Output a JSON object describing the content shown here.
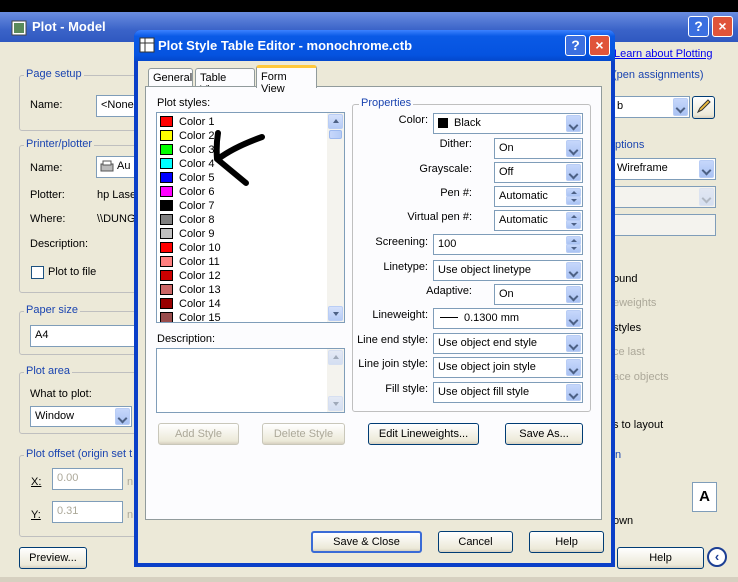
{
  "plot_window": {
    "title": "Plot - Model",
    "help_caption": "?",
    "close_caption": "×",
    "learn_link": "Learn about Plotting",
    "pen_assign": "(pen assignments)",
    "page_setup": {
      "group": "Page setup",
      "name_label": "Name:",
      "name_value": "<None"
    },
    "printer": {
      "group": "Printer/plotter",
      "name_label": "Name:",
      "name_value": "Au",
      "plotter_label": "Plotter:",
      "plotter_value": "hp Lase",
      "where_label": "Where:",
      "where_value": "\\\\DUNG",
      "description_label": "Description:",
      "plot_to_file": "Plot to file"
    },
    "paper": {
      "group": "Paper size",
      "value": "A4"
    },
    "area": {
      "group": "Plot area",
      "what_label": "What to plot:",
      "what_value": "Window"
    },
    "offset": {
      "group": "Plot offset (origin set t",
      "x_label": "X:",
      "x_value": "0.00",
      "x_unit": "n",
      "y_label": "Y:",
      "y_value": "0.31",
      "y_unit": "n"
    },
    "right": {
      "shaded_group": "ptions",
      "shaded_value": "Wireframe",
      "pen_style_value": "b",
      "opt_background": "ound",
      "opt_lineweights": "eweights",
      "opt_styles": "styles",
      "opt_last": "ce last",
      "opt_objects": "ace objects",
      "opt_layout": "s to layout",
      "orient_group": "n",
      "orient_icon": "A",
      "opt_down": "own"
    },
    "preview_button": "Preview...",
    "help_button": "Help"
  },
  "dialog": {
    "title": "Plot Style Table Editor - monochrome.ctb",
    "help_caption": "?",
    "close_caption": "×",
    "tabs": [
      "General",
      "Table View",
      "Form View"
    ],
    "plot_styles_label": "Plot styles:",
    "styles": [
      {
        "name": "Color 1",
        "color": "#ff0000"
      },
      {
        "name": "Color 2",
        "color": "#ffff00"
      },
      {
        "name": "Color 3",
        "color": "#00ff00"
      },
      {
        "name": "Color 4",
        "color": "#00ffff"
      },
      {
        "name": "Color 5",
        "color": "#0000ff"
      },
      {
        "name": "Color 6",
        "color": "#ff00ff"
      },
      {
        "name": "Color 7",
        "color": "#000000"
      },
      {
        "name": "Color 8",
        "color": "#808080"
      },
      {
        "name": "Color 9",
        "color": "#c0c0c0"
      },
      {
        "name": "Color 10",
        "color": "#ff0000"
      },
      {
        "name": "Color 11",
        "color": "#ff7f7f"
      },
      {
        "name": "Color 12",
        "color": "#cc0000"
      },
      {
        "name": "Color 13",
        "color": "#cc6666"
      },
      {
        "name": "Color 14",
        "color": "#990000"
      },
      {
        "name": "Color 15",
        "color": "#994c4c"
      }
    ],
    "description_label": "Description:",
    "add_style": "Add Style",
    "delete_style": "Delete Style",
    "properties": {
      "group": "Properties",
      "color_label": "Color:",
      "color_value": "Black",
      "dither_label": "Dither:",
      "dither_value": "On",
      "grayscale_label": "Grayscale:",
      "grayscale_value": "Off",
      "pen_label": "Pen #:",
      "pen_value": "Automatic",
      "vpen_label": "Virtual pen #:",
      "vpen_value": "Automatic",
      "screening_label": "Screening:",
      "screening_value": "100",
      "linetype_label": "Linetype:",
      "linetype_value": "Use object linetype",
      "adaptive_label": "Adaptive:",
      "adaptive_value": "On",
      "lineweight_label": "Lineweight:",
      "lineweight_value": "0.1300 mm",
      "lineend_label": "Line end style:",
      "lineend_value": "Use object end style",
      "linejoin_label": "Line join style:",
      "linejoin_value": "Use object join style",
      "fill_label": "Fill style:",
      "fill_value": "Use object fill style"
    },
    "edit_lineweights": "Edit Lineweights...",
    "save_as": "Save As...",
    "save_close": "Save & Close",
    "cancel": "Cancel",
    "help": "Help"
  }
}
